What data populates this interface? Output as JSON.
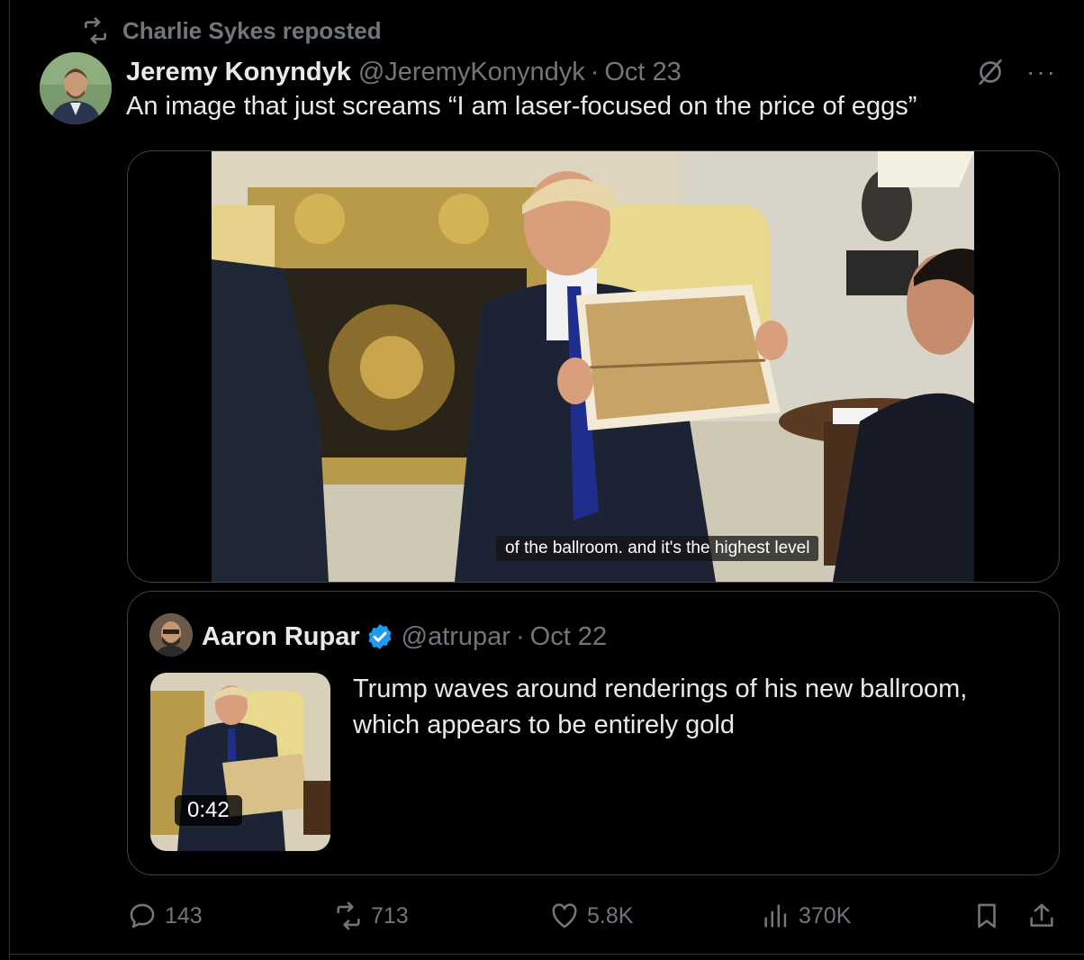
{
  "repost": {
    "label": "Charlie Sykes reposted"
  },
  "tweet": {
    "author_name": "Jeremy Konyndyk",
    "handle": "@JeremyKonyndyk",
    "separator": "·",
    "date": "Oct 23",
    "more": "···",
    "text": "An image that just screams “I am laser-focused on the price of eggs”",
    "media": {
      "caption": "of the ballroom. and it's the highest level"
    }
  },
  "quote": {
    "author_name": "Aaron Rupar",
    "handle": "@atrupar",
    "separator": "·",
    "date": "Oct 22",
    "text": "Trump waves around renderings of his new ballroom, which appears to be entirely gold",
    "duration": "0:42"
  },
  "actions": {
    "replies": "143",
    "reposts": "713",
    "likes": "5.8K",
    "views": "370K"
  },
  "colors": {
    "background": "#000000",
    "text": "#e7e9ea",
    "muted": "#71767b",
    "border": "#2f3336",
    "verified": "#1d9bf0"
  },
  "icons": [
    "repost-icon",
    "grok-icon",
    "more-icon",
    "verified-badge-icon",
    "reply-icon",
    "repost-icon",
    "like-icon",
    "views-icon",
    "bookmark-icon",
    "share-icon"
  ]
}
